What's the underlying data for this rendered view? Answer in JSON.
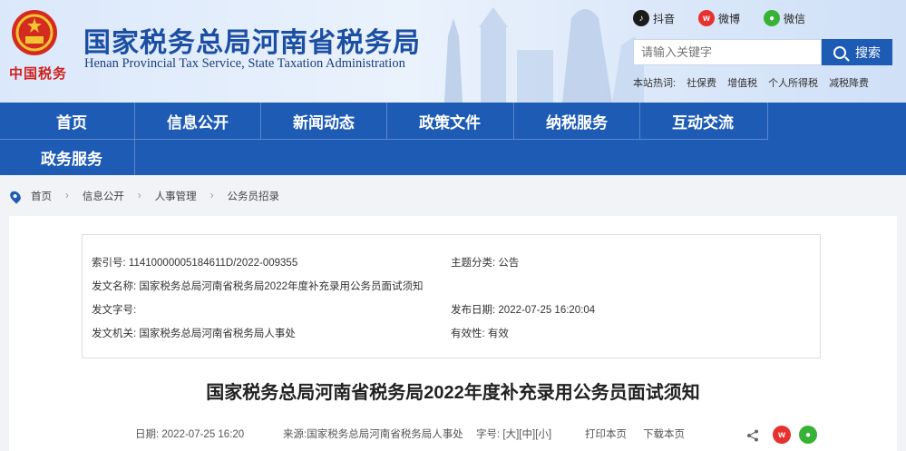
{
  "header": {
    "title_cn": "国家税务总局河南省税务局",
    "title_en": "Henan Provincial Tax Service, State Taxation Administration",
    "brand_script": "中国税务",
    "social": [
      {
        "label": "抖音",
        "icon": "douyin-icon"
      },
      {
        "label": "微博",
        "icon": "weibo-icon"
      },
      {
        "label": "微信",
        "icon": "wechat-icon"
      }
    ],
    "search": {
      "placeholder": "请输入关键字",
      "button": "搜索"
    },
    "hot": {
      "label": "本站热词:",
      "items": [
        "社保费",
        "增值税",
        "个人所得税",
        "减税降费"
      ]
    }
  },
  "nav": [
    "首页",
    "信息公开",
    "新闻动态",
    "政策文件",
    "纳税服务",
    "互动交流",
    "政务服务"
  ],
  "breadcrumb": [
    "首页",
    "信息公开",
    "人事管理",
    "公务员招录"
  ],
  "meta": {
    "index_label": "索引号:",
    "index_value": "11410000005184611D/2022-009355",
    "topic_label": "主题分类:",
    "topic_value": "公告",
    "name_label": "发文名称:",
    "name_value": "国家税务总局河南省税务局2022年度补充录用公务员面试须知",
    "num_label": "发文字号:",
    "num_value": "",
    "date_label": "发布日期:",
    "date_value": "2022-07-25 16:20:04",
    "org_label": "发文机关:",
    "org_value": "国家税务总局河南省税务局人事处",
    "valid_label": "有效性:",
    "valid_value": "有效"
  },
  "article": {
    "title": "国家税务总局河南省税务局2022年度补充录用公务员面试须知",
    "date": "日期: 2022-07-25 16:20",
    "source": "来源:国家税务总局河南省税务局人事处",
    "font_label": "字号:",
    "font_large": "[大]",
    "font_medium": "[中]",
    "font_small": "[小]",
    "print": "打印本页",
    "download": "下载本页"
  },
  "colors": {
    "primary": "#1e5bb5",
    "title": "#1c4fa3",
    "weibo": "#e6322e",
    "wechat": "#38b236"
  }
}
